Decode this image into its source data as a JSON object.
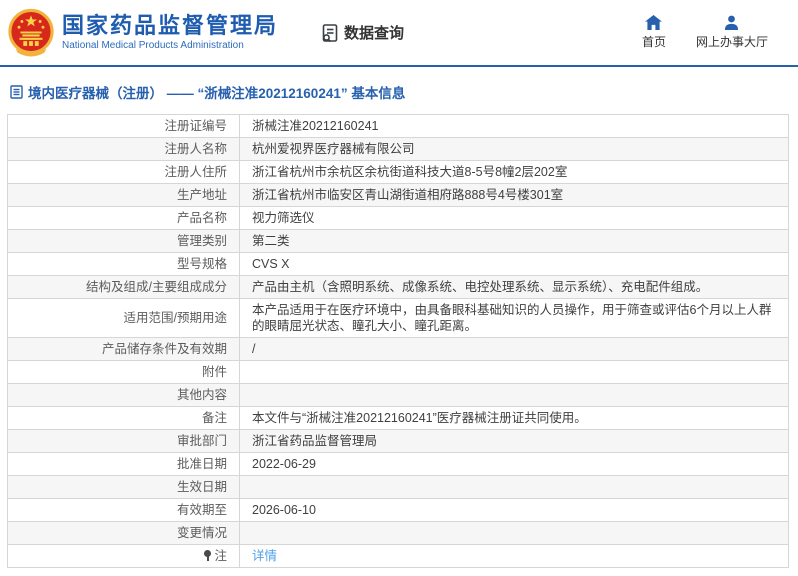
{
  "header": {
    "agency_name_cn": "国家药品监督管理局",
    "agency_name_en": "National Medical Products Administration",
    "data_query_label": "数据查询",
    "nav": {
      "home": "首页",
      "service_hall": "网上办事大厅"
    }
  },
  "page": {
    "title": "境内医疗器械（注册） ——  “浙械注准20212160241”  基本信息"
  },
  "table": {
    "rows": [
      {
        "label": "注册证编号",
        "value": "浙械注准20212160241"
      },
      {
        "label": "注册人名称",
        "value": "杭州爱视界医疗器械有限公司"
      },
      {
        "label": "注册人住所",
        "value": "浙江省杭州市余杭区余杭街道科技大道8-5号8幢2层202室"
      },
      {
        "label": "生产地址",
        "value": "浙江省杭州市临安区青山湖街道相府路888号4号楼301室"
      },
      {
        "label": "产品名称",
        "value": "视力筛选仪"
      },
      {
        "label": "管理类别",
        "value": "第二类"
      },
      {
        "label": "型号规格",
        "value": "CVS X"
      },
      {
        "label": "结构及组成/主要组成成分",
        "value": "产品由主机（含照明系统、成像系统、电控处理系统、显示系统）、充电配件组成。"
      },
      {
        "label": "适用范围/预期用途",
        "value": "本产品适用于在医疗环境中，由具备眼科基础知识的人员操作，用于筛查或评估6个月以上人群的眼睛屈光状态、瞳孔大小、瞳孔距离。"
      },
      {
        "label": "产品储存条件及有效期",
        "value": "/"
      },
      {
        "label": "附件",
        "value": ""
      },
      {
        "label": "其他内容",
        "value": ""
      },
      {
        "label": "备注",
        "value": "本文件与“浙械注准20212160241”医疗器械注册证共同使用。"
      },
      {
        "label": "审批部门",
        "value": "浙江省药品监督管理局"
      },
      {
        "label": "批准日期",
        "value": "2022-06-29"
      },
      {
        "label": "生效日期",
        "value": ""
      },
      {
        "label": "有效期至",
        "value": "2026-06-10"
      },
      {
        "label": "变更情况",
        "value": ""
      },
      {
        "label": "注",
        "label_icon": "note-pin-icon",
        "value": "详情",
        "value_type": "link"
      }
    ]
  },
  "colors": {
    "accent_blue": "#2760ae",
    "brand_blue": "#1f5cb0",
    "link_blue": "#4e9fe8",
    "alt_row_bg": "#f6f6f6",
    "emblem_red": "#d7281c",
    "emblem_gold": "#f2b33d"
  }
}
